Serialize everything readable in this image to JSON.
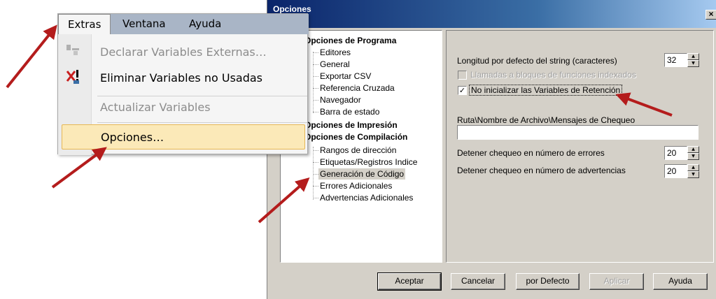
{
  "colors": {
    "arrow": "#b41c1c",
    "titlebar_start": "#0a246a",
    "menu_highlight": "#fbe9b8",
    "menubar": "#a9b5c6"
  },
  "dialog": {
    "title": "Opciones",
    "close_label": "×",
    "tree": {
      "groups": [
        {
          "label": "Opciones de Programa",
          "items": [
            "Editores",
            "General",
            "Exportar CSV",
            "Referencia Cruzada",
            "Navegador",
            "Barra de estado"
          ]
        },
        {
          "label": "Opciones de Impresión",
          "items": []
        },
        {
          "label": "Opciones de Compilación",
          "items": [
            "Rangos de dirección",
            "Etiquetas/Registros Indice",
            "Generación de Código",
            "Errores Adicionales",
            "Advertencias Adicionales"
          ]
        }
      ],
      "selected": "Generación de Código"
    },
    "settings": {
      "string_length_label": "Longitud por defecto del string (caracteres)",
      "string_length_value": "32",
      "indexed_calls_label": "Llamadas a bloques de funciones indexados",
      "indexed_calls_checked": false,
      "retain_label": "No inicializar las Variables de Retención",
      "retain_checked": true,
      "check_mark": "✓",
      "path_label": "Ruta\\Nombre de Archivo\\Mensajes de Chequeo",
      "path_value": "",
      "stop_errors_label": "Detener chequeo en número de errores",
      "stop_errors_value": "20",
      "stop_warnings_label": "Detener chequeo en número de advertencias",
      "stop_warnings_value": "20",
      "spin_up": "▲",
      "spin_down": "▼"
    },
    "buttons": {
      "ok": "Aceptar",
      "cancel": "Cancelar",
      "default": "por Defecto",
      "apply": "Aplicar",
      "help": "Ayuda"
    }
  },
  "menu": {
    "menubar": [
      "Extras",
      "Ventana",
      "Ayuda"
    ],
    "active_tab": "Extras",
    "items": [
      {
        "label": "Declarar Variables Externas…",
        "disabled": true,
        "icon": "declare-variables-icon"
      },
      {
        "label": "Eliminar Variables no Usadas",
        "disabled": false,
        "icon": "remove-unused-variables-icon"
      },
      {
        "label": "Actualizar Variables",
        "disabled": true,
        "icon": ""
      },
      {
        "label": "Opciones…",
        "disabled": false,
        "icon": "",
        "highlighted": true
      }
    ]
  }
}
